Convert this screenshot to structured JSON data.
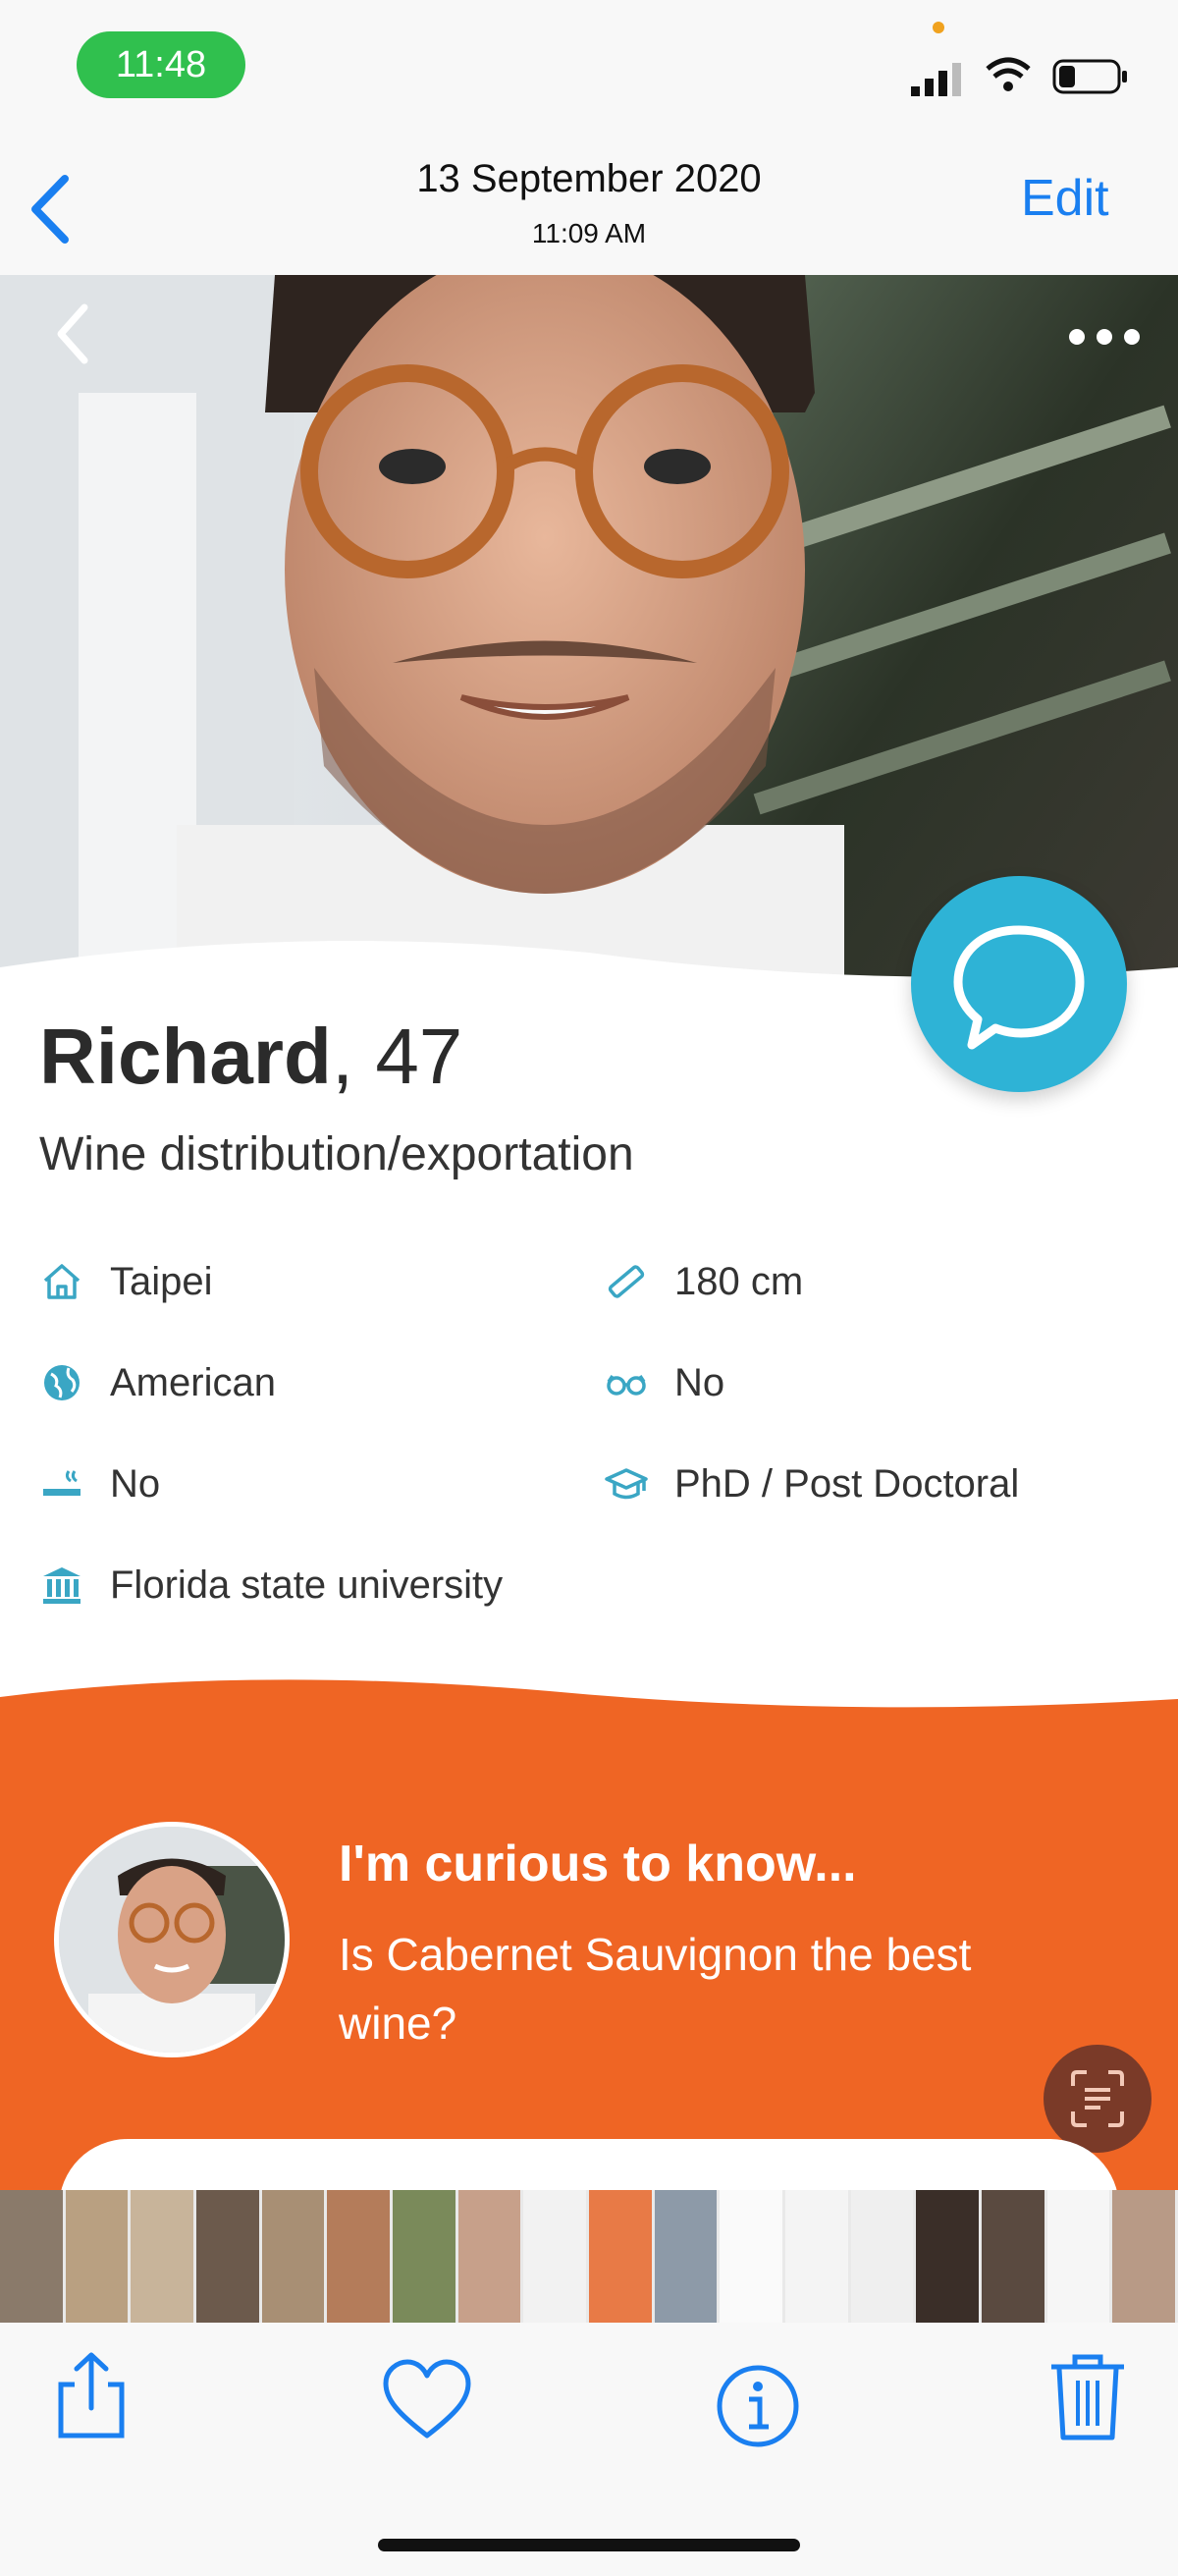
{
  "status_bar": {
    "time": "11:48"
  },
  "header": {
    "date": "13 September 2020",
    "time": "11:09 AM",
    "edit_label": "Edit"
  },
  "profile": {
    "name": "Richard",
    "age": ", 47",
    "occupation": "Wine distribution/exportation",
    "attributes": [
      {
        "icon": "home-icon",
        "label": "Taipei"
      },
      {
        "icon": "ruler-icon",
        "label": "180 cm"
      },
      {
        "icon": "globe-icon",
        "label": "American"
      },
      {
        "icon": "glasses-icon",
        "label": "No"
      },
      {
        "icon": "smoking-icon",
        "label": "No"
      },
      {
        "icon": "graduation-cap-icon",
        "label": "PhD / Post Doctoral"
      },
      {
        "icon": "university-icon",
        "label": "Florida state university"
      }
    ]
  },
  "curious": {
    "heading": "I'm curious to know...",
    "question": "Is Cabernet Sauvignon the best wine?"
  },
  "colors": {
    "accent_blue": "#1a7ff0",
    "chat_teal": "#2eb3d6",
    "orange": "#ef6524",
    "icon_teal": "#3aa6c4"
  },
  "toolbar": {
    "icons": [
      "share-icon",
      "heart-icon",
      "info-icon",
      "trash-icon"
    ]
  }
}
